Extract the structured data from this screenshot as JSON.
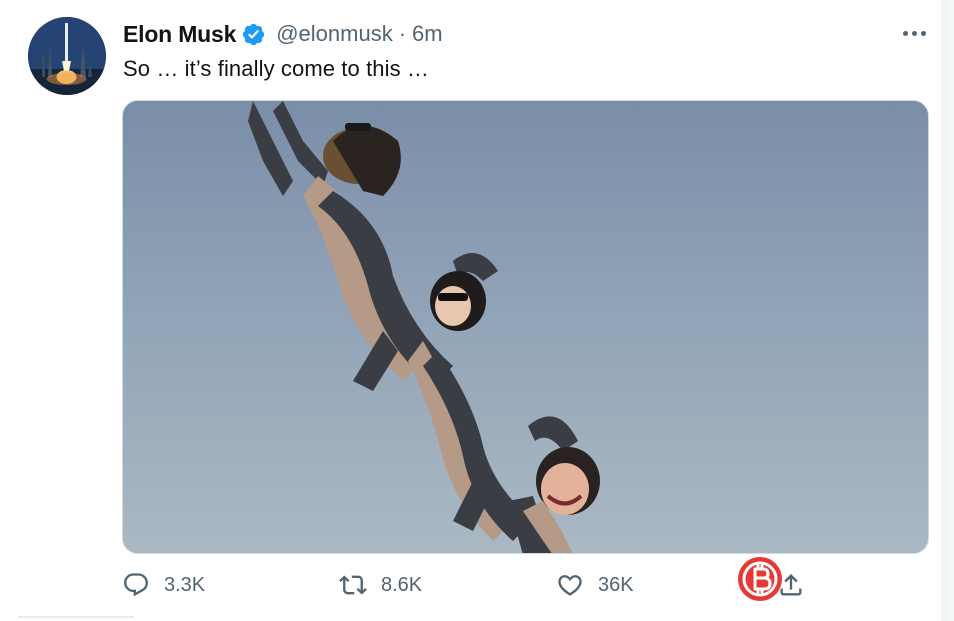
{
  "tweet": {
    "author_name": "Elon Musk",
    "handle": "@elonmusk",
    "separator": "·",
    "time": "6m",
    "text": "So … it’s finally come to this …",
    "verified": true
  },
  "actions": {
    "reply_count": "3.3K",
    "retweet_count": "8.6K",
    "like_count": "36K"
  },
  "icons": {
    "more": "more-horizontal-icon",
    "reply": "reply-icon",
    "retweet": "retweet-icon",
    "like": "heart-icon",
    "share": "share-icon",
    "verified": "verified-badge-icon",
    "watermark": "bitcoin-icon"
  },
  "colors": {
    "verified_blue": "#1d9bf0",
    "secondary_text": "#536471",
    "primary_text": "#0f1419",
    "watermark_red": "#e53935"
  },
  "media": {
    "description": "meme-image"
  }
}
